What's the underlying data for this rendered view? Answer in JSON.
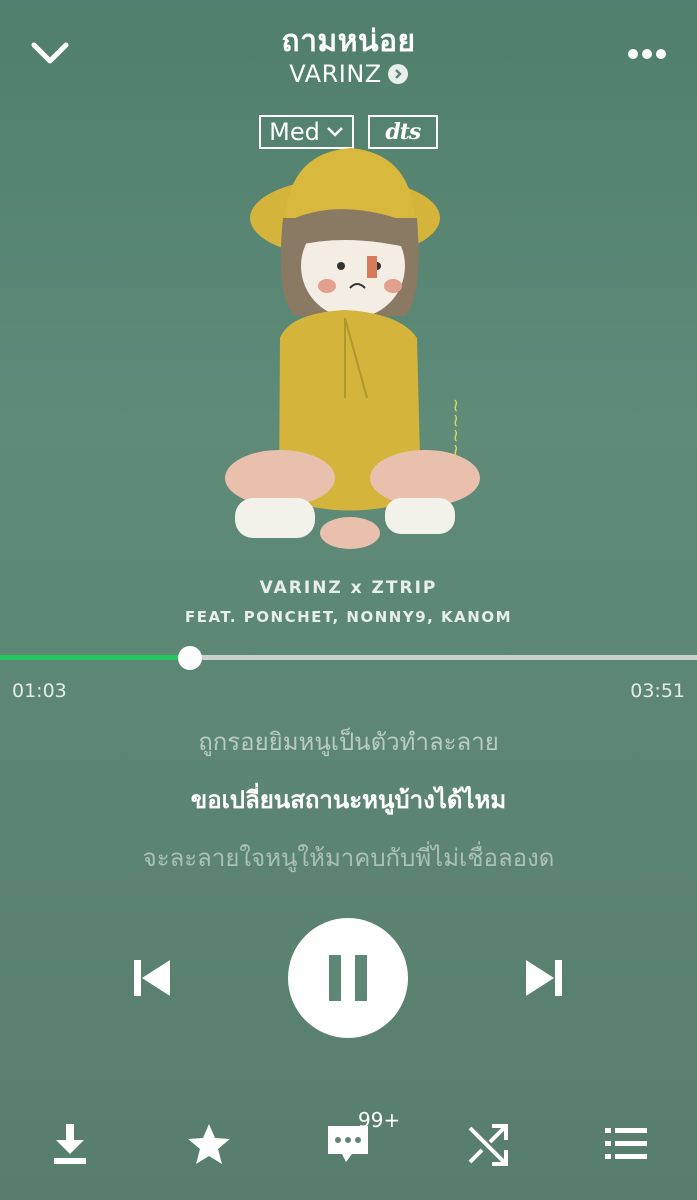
{
  "header": {
    "title": "ถามหน่อย",
    "artist": "VARINZ",
    "quality_label": "Med",
    "dts_label": "dts"
  },
  "artwork": {
    "caption_line1": "VARINZ x ZTRIP",
    "caption_line2": "FEAT. PONCHET, NONNY9, KANOM"
  },
  "player": {
    "current_time": "01:03",
    "total_time": "03:51",
    "progress_fraction": 0.273
  },
  "lyrics": {
    "previous": "ถูกรอยยิมหนูเป็นตัวทำละลาย",
    "current": "ขอเปลี่ยนสถานะหนูบ้างได้ไหม",
    "next": "จะละลายใจหนูให้มาคบกับพี่ไม่เชื่อลองด"
  },
  "bottom_bar": {
    "comment_badge": "99+"
  },
  "colors": {
    "background": "#5f8b79",
    "accent": "#22c55e",
    "track": "#c8d3ce"
  },
  "icons": [
    "chevron-down-icon",
    "more-icon",
    "chevron-right-icon",
    "skip-previous-icon",
    "pause-icon",
    "skip-next-icon",
    "download-icon",
    "star-icon",
    "comment-icon",
    "shuffle-icon",
    "playlist-icon"
  ]
}
